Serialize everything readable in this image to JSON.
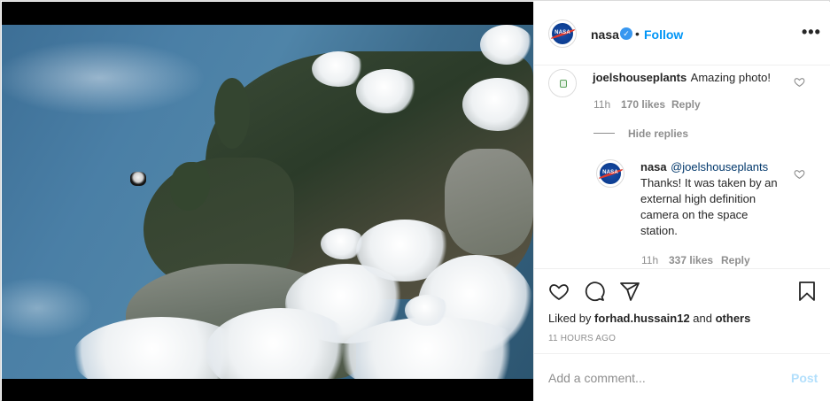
{
  "post": {
    "author": "nasa",
    "verified": true,
    "separator": "•",
    "follow_label": "Follow",
    "more_label": "•••"
  },
  "comments": [
    {
      "username": "joelshouseplants",
      "text": "Amazing photo!",
      "time": "11h",
      "likes": "170 likes",
      "reply_label": "Reply"
    }
  ],
  "hide_replies_label": "Hide replies",
  "replies": [
    {
      "username": "nasa",
      "mention": "@joelshouseplants",
      "text": "Thanks! It was taken by an external high definition camera on the space station.",
      "time": "11h",
      "likes": "337 likes",
      "reply_label": "Reply"
    }
  ],
  "liked_by": {
    "prefix": "Liked by ",
    "user": "forhad.hussain12",
    "conj": " and ",
    "others": "others"
  },
  "timestamp": "11 HOURS AGO",
  "comment_box": {
    "placeholder": "Add a comment...",
    "post_label": "Post"
  },
  "icons": [
    "more-options-icon",
    "verified-badge-icon",
    "heart-icon",
    "comment-icon",
    "share-icon",
    "save-icon"
  ],
  "colors": {
    "accent": "#0095f6",
    "verified": "#3897f0",
    "post_disabled": "#b2dffc",
    "muted": "#8e8e8e"
  }
}
